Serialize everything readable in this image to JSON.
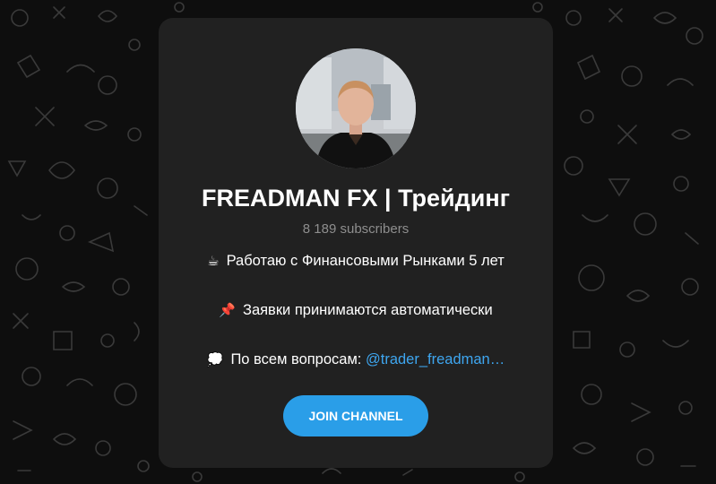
{
  "channel": {
    "title": "FREADMAN FX | Трейдинг",
    "subscribers": "8 189 subscribers",
    "description": [
      {
        "icon": "☕",
        "text": "Работаю с Финансовыми Рынками 5 лет"
      },
      {
        "icon": "📌",
        "text": "Заявки принимаются автоматически"
      },
      {
        "icon": "💭",
        "text": "По всем вопросам: ",
        "mention": "@trader_freadman…"
      }
    ]
  },
  "actions": {
    "join_label": "JOIN CHANNEL"
  },
  "colors": {
    "background": "#0e0e0e",
    "card": "#212121",
    "accent": "#2a9ee8",
    "link": "#3ea6f0",
    "muted": "#8e8e8e"
  }
}
